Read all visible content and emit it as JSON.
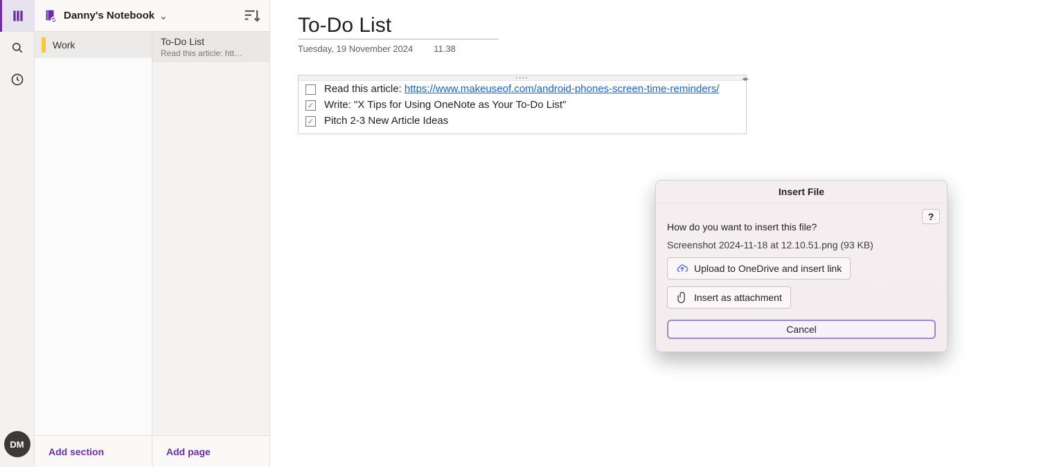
{
  "rail": {
    "avatar_initials": "DM"
  },
  "notebook": {
    "title": "Danny's Notebook"
  },
  "sections": [
    {
      "name": "Work",
      "color": "#f7c93e"
    }
  ],
  "pages": [
    {
      "title": "To-Do List",
      "preview": "Read this article: htt…"
    }
  ],
  "footer": {
    "add_section": "Add section",
    "add_page": "Add page"
  },
  "page": {
    "title": "To-Do List",
    "date": "Tuesday, 19 November 2024",
    "time": "11.38",
    "items": [
      {
        "checked": false,
        "prefix": "Read this article: ",
        "link_text": "https://www.makeuseof.com/android-phones-screen-time-reminders/",
        "link_href": "https://www.makeuseof.com/android-phones-screen-time-reminders/"
      },
      {
        "checked": true,
        "text": "Write: \"X Tips for Using OneNote as Your To-Do List\""
      },
      {
        "checked": true,
        "text": "Pitch 2-3 New Article Ideas"
      }
    ]
  },
  "modal": {
    "title": "Insert File",
    "question": "How do you want to insert this file?",
    "filename": "Screenshot 2024-11-18 at 12.10.51.png (93 KB)",
    "upload_label": "Upload to OneDrive and insert link",
    "attach_label": "Insert as attachment",
    "cancel_label": "Cancel",
    "help_label": "?"
  }
}
